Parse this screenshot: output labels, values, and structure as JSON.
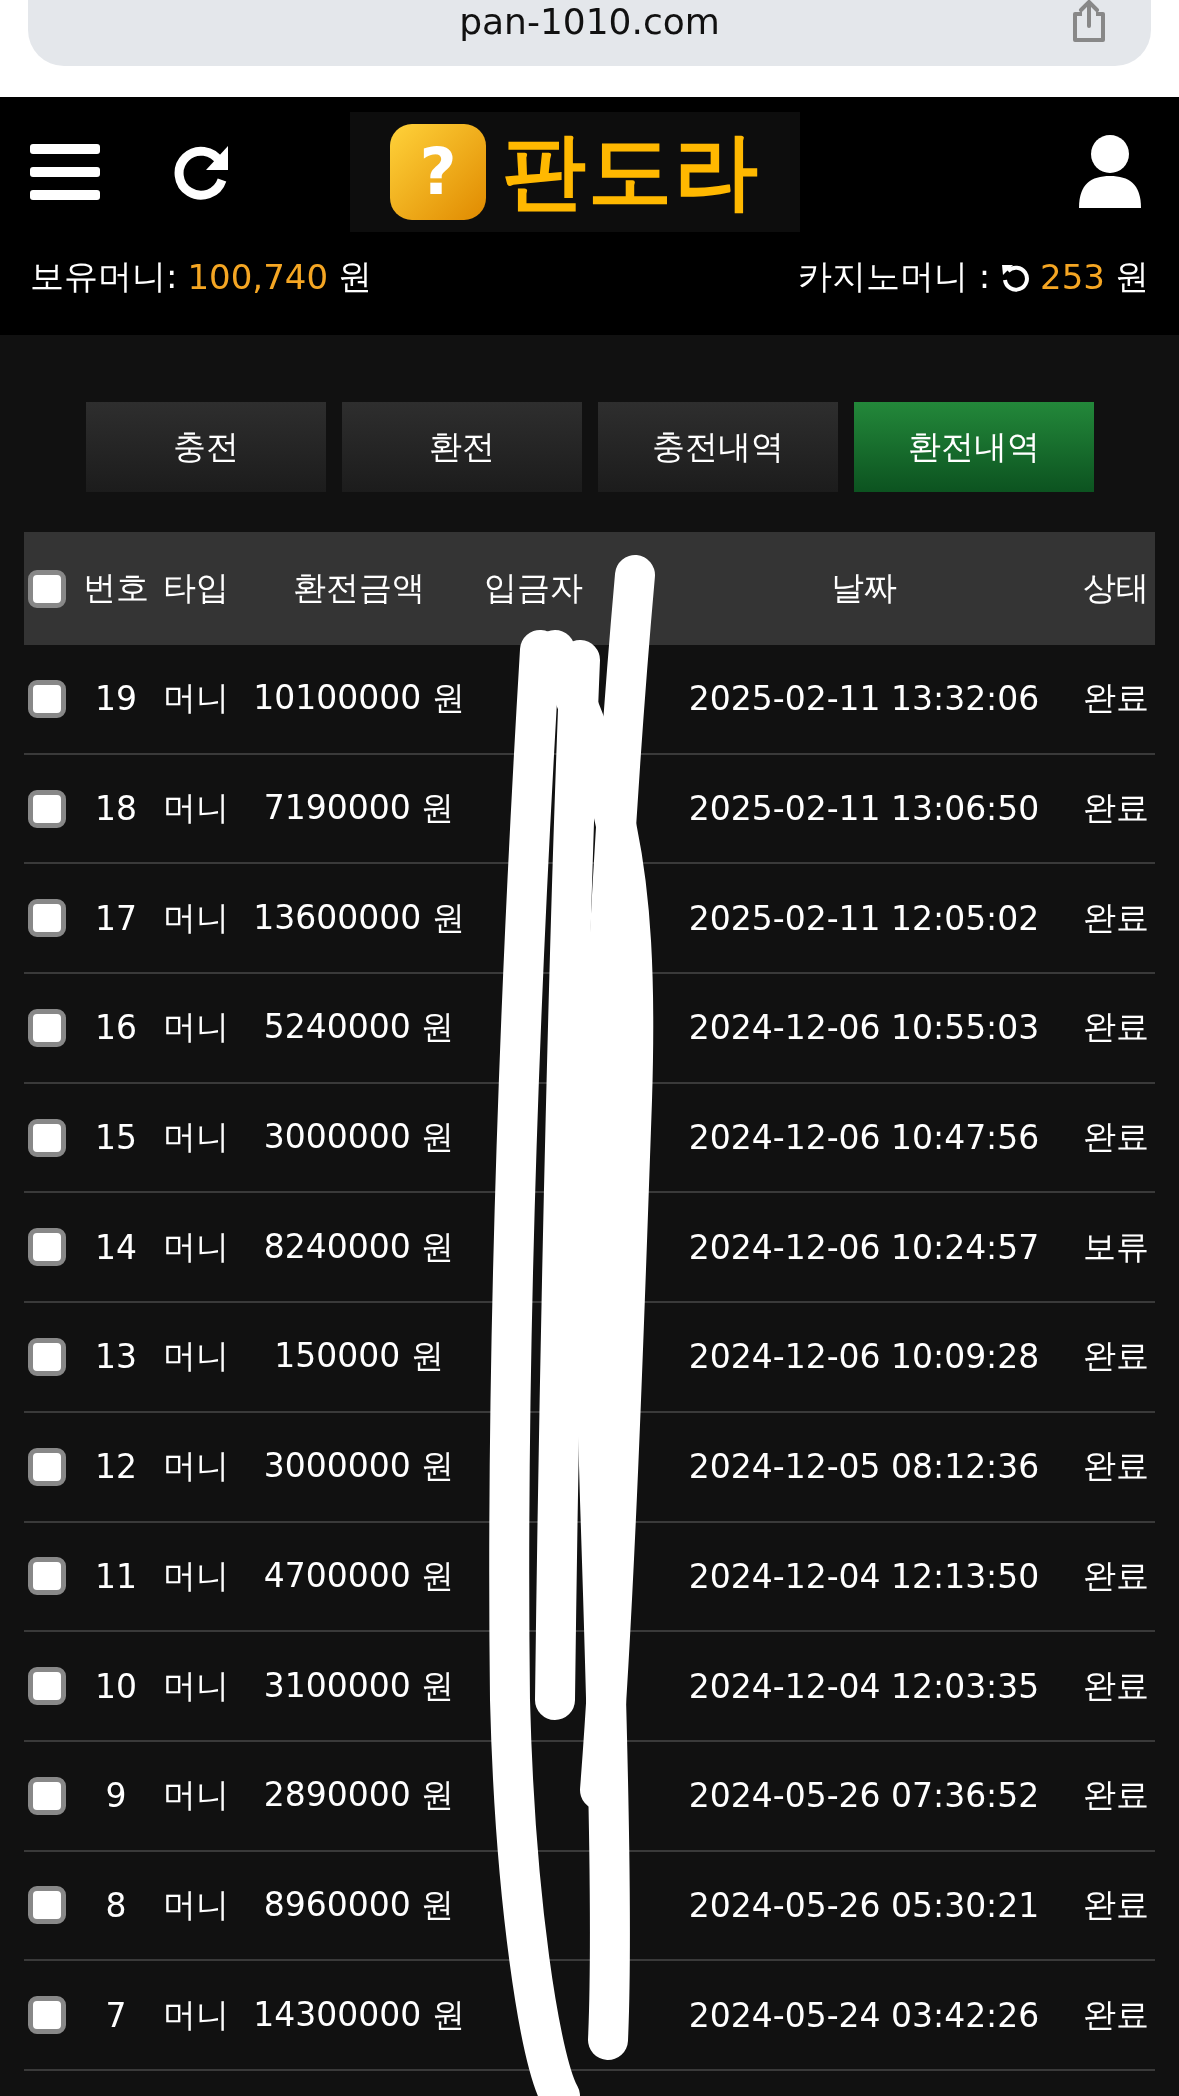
{
  "browser": {
    "url": "pan-1010.com"
  },
  "header": {
    "logo": {
      "mark": "?",
      "text": "판도라"
    }
  },
  "balance": {
    "label": "보유머니:",
    "amount": "100,740",
    "unit": "원"
  },
  "casino": {
    "label": "카지노머니 :",
    "amount": "253",
    "unit": "원"
  },
  "tabs": [
    {
      "label": "충전",
      "selected": false
    },
    {
      "label": "환전",
      "selected": false
    },
    {
      "label": "충전내역",
      "selected": false
    },
    {
      "label": "환전내역",
      "selected": true
    }
  ],
  "table": {
    "select_all": {
      "checked": false
    },
    "columns": [
      "번호",
      "타입",
      "환전금액",
      "입금자",
      "날짜",
      "상태"
    ],
    "rows": [
      {
        "checked": false,
        "no": "19",
        "type": "머니",
        "amount": "10100000 원",
        "date": "2025-02-11 13:32:06",
        "status": "완료"
      },
      {
        "checked": false,
        "no": "18",
        "type": "머니",
        "amount": "7190000 원",
        "date": "2025-02-11 13:06:50",
        "status": "완료"
      },
      {
        "checked": false,
        "no": "17",
        "type": "머니",
        "amount": "13600000 원",
        "date": "2025-02-11 12:05:02",
        "status": "완료"
      },
      {
        "checked": false,
        "no": "16",
        "type": "머니",
        "amount": "5240000 원",
        "date": "2024-12-06 10:55:03",
        "status": "완료"
      },
      {
        "checked": false,
        "no": "15",
        "type": "머니",
        "amount": "3000000 원",
        "date": "2024-12-06 10:47:56",
        "status": "완료"
      },
      {
        "checked": false,
        "no": "14",
        "type": "머니",
        "amount": "8240000 원",
        "date": "2024-12-06 10:24:57",
        "status": "보류"
      },
      {
        "checked": false,
        "no": "13",
        "type": "머니",
        "amount": "150000 원",
        "date": "2024-12-06 10:09:28",
        "status": "완료"
      },
      {
        "checked": false,
        "no": "12",
        "type": "머니",
        "amount": "3000000 원",
        "date": "2024-12-05 08:12:36",
        "status": "완료"
      },
      {
        "checked": false,
        "no": "11",
        "type": "머니",
        "amount": "4700000 원",
        "date": "2024-12-04 12:13:50",
        "status": "완료"
      },
      {
        "checked": false,
        "no": "10",
        "type": "머니",
        "amount": "3100000 원",
        "date": "2024-12-04 12:03:35",
        "status": "완료"
      },
      {
        "checked": false,
        "no": "9",
        "type": "머니",
        "amount": "2890000 원",
        "date": "2024-05-26 07:36:52",
        "status": "완료"
      },
      {
        "checked": false,
        "no": "8",
        "type": "머니",
        "amount": "8960000 원",
        "date": "2024-05-26 05:30:21",
        "status": "완료"
      },
      {
        "checked": false,
        "no": "7",
        "type": "머니",
        "amount": "14300000 원",
        "date": "2024-05-24 03:42:26",
        "status": "완료"
      }
    ]
  }
}
